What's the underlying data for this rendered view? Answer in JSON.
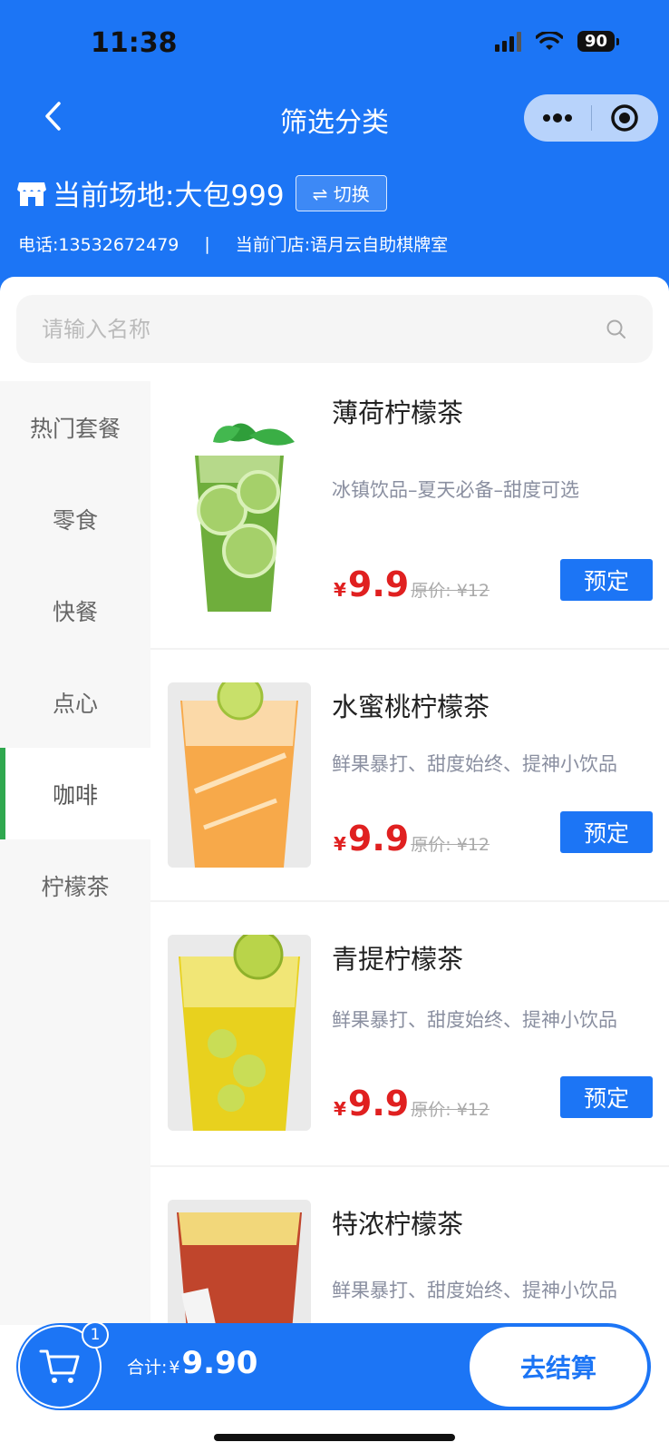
{
  "status_bar": {
    "time": "11:38",
    "battery": "90"
  },
  "nav": {
    "title": "筛选分类"
  },
  "venue": {
    "label": "当前场地:大包999",
    "switch_label": "⇌ 切换"
  },
  "info": {
    "phone": "电话:13532672479",
    "divider": "|",
    "store": "当前门店:语月云自助棋牌室"
  },
  "search": {
    "placeholder": "请输入名称"
  },
  "sidebar": {
    "items": [
      {
        "label": "热门套餐"
      },
      {
        "label": "零食"
      },
      {
        "label": "快餐"
      },
      {
        "label": "点心"
      },
      {
        "label": "咖啡"
      },
      {
        "label": "柠檬茶"
      }
    ],
    "active_index": 4
  },
  "products": [
    {
      "name": "薄荷柠檬茶",
      "desc": "冰镇饮品–夏天必备–甜度可选",
      "price_symbol": "¥",
      "price": "9.9",
      "orig_price": "原价: ¥12",
      "button": "预定"
    },
    {
      "name": "水蜜桃柠檬茶",
      "desc": "鲜果暴打、甜度始终、提神小饮品",
      "price_symbol": "¥",
      "price": "9.9",
      "orig_price": "原价: ¥12",
      "button": "预定"
    },
    {
      "name": "青提柠檬茶",
      "desc": "鲜果暴打、甜度始终、提神小饮品",
      "price_symbol": "¥",
      "price": "9.9",
      "orig_price": "原价: ¥12",
      "button": "预定"
    },
    {
      "name": "特浓柠檬茶",
      "desc": "鲜果暴打、甜度始终、提神小饮品"
    }
  ],
  "cart": {
    "count": "1",
    "total_label": "合计:",
    "total_symbol": "¥",
    "total": "9.90",
    "checkout_label": "去结算"
  },
  "colors": {
    "primary": "#1c75f5",
    "price": "#e02020",
    "active_indicator": "#2fa84f"
  }
}
